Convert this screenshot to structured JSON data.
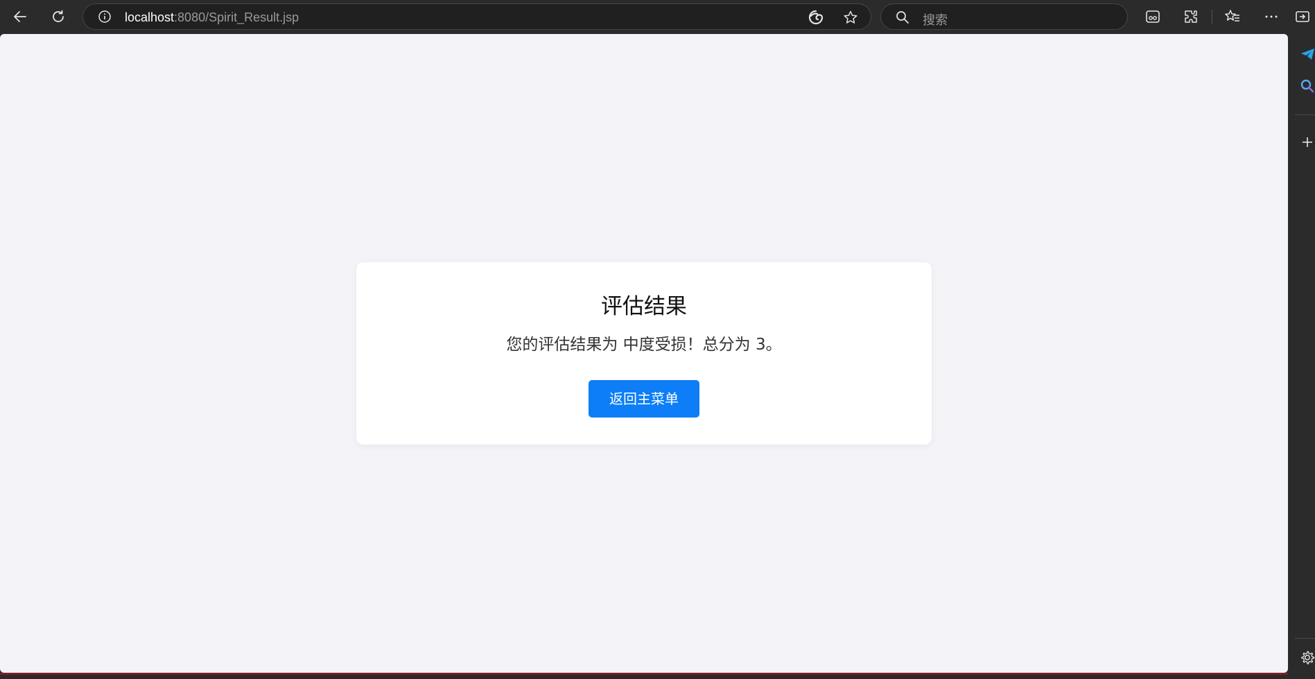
{
  "browser": {
    "address": {
      "host": "localhost",
      "path": ":8080/Spirit_Result.jsp"
    },
    "search": {
      "placeholder": "搜索"
    }
  },
  "page": {
    "title": "评估结果",
    "message": "您的评估结果为 中度受损！总分为 3。",
    "back_button_label": "返回主菜单"
  },
  "colors": {
    "button": "#0d7ef7",
    "page_background": "#f4f4f8",
    "browser_chrome": "#2b2b2b"
  }
}
